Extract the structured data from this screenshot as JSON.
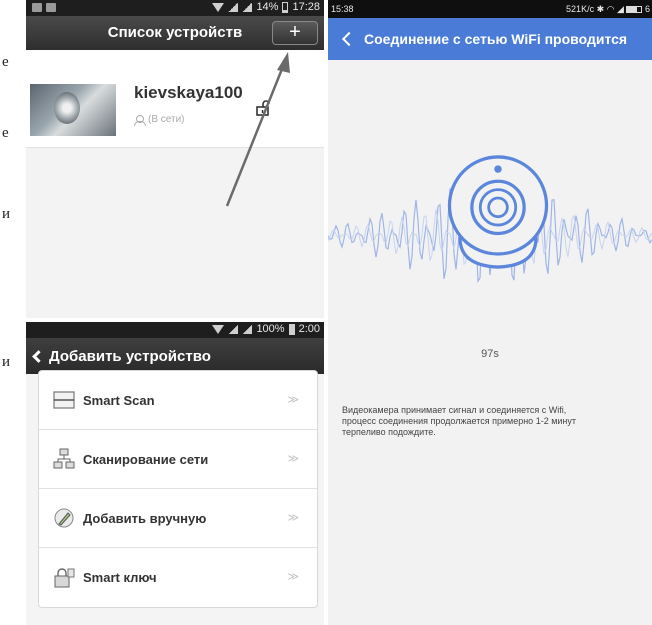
{
  "page_fragment": [
    "е",
    "е",
    "и",
    "и"
  ],
  "device_list": {
    "status_bar": {
      "battery": "14%",
      "time": "17:28"
    },
    "title": "Список устройств",
    "add_label": "+",
    "device": {
      "name": "kievskaya100",
      "status": "(В сети)"
    }
  },
  "add_device": {
    "status_bar": {
      "battery": "100%",
      "time": "2:00"
    },
    "title": "Добавить устройство",
    "items": [
      {
        "label": "Smart Scan",
        "icon": "scan-frame-icon",
        "arrow": "≫"
      },
      {
        "label": "Сканирование сети",
        "icon": "network-icon",
        "arrow": "≫"
      },
      {
        "label": "Добавить вручную",
        "icon": "pen-icon",
        "arrow": "≫"
      },
      {
        "label": "Smart ключ",
        "icon": "key-lock-icon",
        "arrow": "≫"
      }
    ]
  },
  "wifi_connect": {
    "status_bar": {
      "time": "15:38",
      "speed": "521K/c",
      "battery": "6"
    },
    "title": "Соединение с сетью WiFi проводится",
    "timer": "97s",
    "message": [
      "Видеокамера принимает сигнал и соединяется с Wifi,",
      " процесс соединения продолжается примерно 1-2 минут",
      "терпеливо подождите."
    ]
  },
  "colors": {
    "accent_blue": "#4a7cd7",
    "header_dark": "#333333",
    "wave": "#8fa8e0"
  }
}
